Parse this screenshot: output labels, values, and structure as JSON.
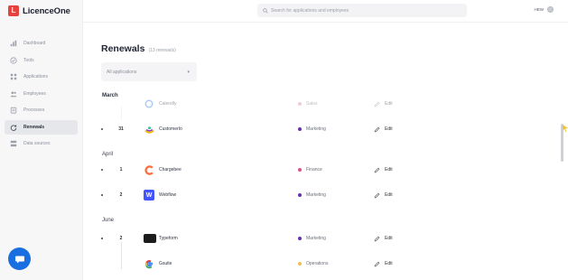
{
  "app": {
    "brand": "LicenceOne",
    "brand_mark": "L"
  },
  "colors": {
    "accent": "#1a6fe0",
    "brand": "#e8423f"
  },
  "sidebar": {
    "items": [
      {
        "label": "Dashboard",
        "icon": "bar-chart-icon",
        "active": false
      },
      {
        "label": "Tools",
        "icon": "check-circle-icon",
        "active": false
      },
      {
        "label": "Applications",
        "icon": "grid-icon",
        "active": false
      },
      {
        "label": "Employees",
        "icon": "users-icon",
        "active": false
      },
      {
        "label": "Processes",
        "icon": "clipboard-icon",
        "active": false
      },
      {
        "label": "Renewals",
        "icon": "refresh-icon",
        "active": true
      },
      {
        "label": "Data sources",
        "icon": "database-icon",
        "active": false
      }
    ]
  },
  "topbar": {
    "search_placeholder": "Search for applications and employees",
    "user_label": "HEW"
  },
  "main": {
    "title": "Renewals",
    "count": "(13 renewals)",
    "filter": {
      "selected": "All applications"
    },
    "groups": [
      {
        "month": "March",
        "rows": [
          {
            "day": "",
            "app": "Calendly",
            "icon_color": "#4a8df0",
            "icon_char": "",
            "dept": "Sales",
            "dept_color": "#e58aa0",
            "edit": "Edit",
            "faded": true
          },
          {
            "day": "31",
            "app": "CustomerIo",
            "icon_color": "#ffffff",
            "icon_char": "",
            "dept": "Marketing",
            "dept_color": "#6b2fa8",
            "edit": "Edit",
            "faded": false
          }
        ]
      },
      {
        "month": "April",
        "rows": [
          {
            "day": "1",
            "app": "Chargebee",
            "icon_color": "#ffffff",
            "icon_char": "C",
            "dept": "Finance",
            "dept_color": "#e0508a",
            "edit": "Edit",
            "faded": false
          },
          {
            "day": "2",
            "app": "Webflow",
            "icon_color": "#4353ff",
            "icon_char": "W",
            "dept": "Marketing",
            "dept_color": "#6b2fa8",
            "edit": "Edit",
            "faded": false
          }
        ]
      },
      {
        "month": "June",
        "rows": [
          {
            "day": "2",
            "app": "Typeform",
            "icon_color": "#1c1c1c",
            "icon_char": "",
            "dept": "Marketing",
            "dept_color": "#6b2fa8",
            "edit": "Edit",
            "faded": false
          },
          {
            "day": "",
            "app": "Gsuite",
            "icon_color": "#ffffff",
            "icon_char": "G",
            "dept": "Operations",
            "dept_color": "#f2c14b",
            "edit": "Edit",
            "faded": false
          }
        ]
      }
    ]
  }
}
